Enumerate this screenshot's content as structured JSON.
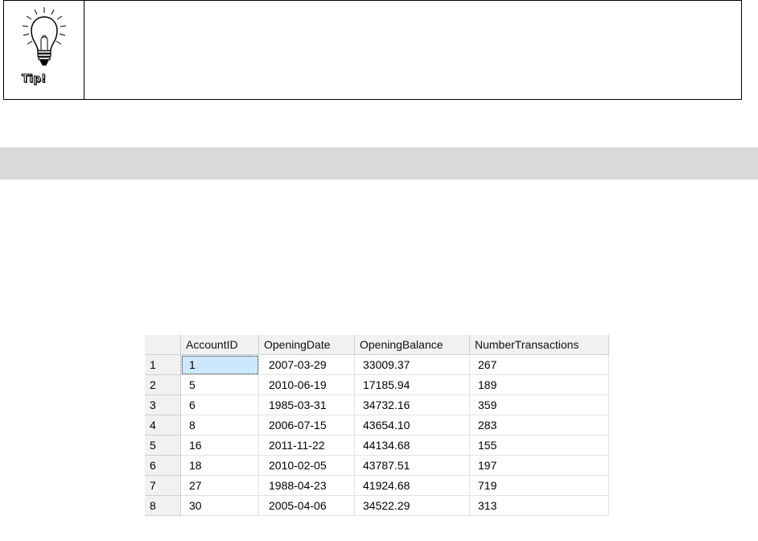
{
  "tip": {
    "label": "Tip!",
    "icon": "lightbulb-icon"
  },
  "grid": {
    "headers": [
      "AccountID",
      "OpeningDate",
      "OpeningBalance",
      "NumberTransactions"
    ],
    "rows": [
      {
        "num": "1",
        "account_id": "1",
        "opening_date": "2007-03-29",
        "opening_balance": "33009.37",
        "number_transactions": "267"
      },
      {
        "num": "2",
        "account_id": "5",
        "opening_date": "2010-06-19",
        "opening_balance": "17185.94",
        "number_transactions": "189"
      },
      {
        "num": "3",
        "account_id": "6",
        "opening_date": "1985-03-31",
        "opening_balance": "34732.16",
        "number_transactions": "359"
      },
      {
        "num": "4",
        "account_id": "8",
        "opening_date": "2006-07-15",
        "opening_balance": "43654.10",
        "number_transactions": "283"
      },
      {
        "num": "5",
        "account_id": "16",
        "opening_date": "2011-11-22",
        "opening_balance": "44134.68",
        "number_transactions": "155"
      },
      {
        "num": "6",
        "account_id": "18",
        "opening_date": "2010-02-05",
        "opening_balance": "43787.51",
        "number_transactions": "197"
      },
      {
        "num": "7",
        "account_id": "27",
        "opening_date": "1988-04-23",
        "opening_balance": "41924.68",
        "number_transactions": "719"
      },
      {
        "num": "8",
        "account_id": "30",
        "opening_date": "2005-04-06",
        "opening_balance": "34522.29",
        "number_transactions": "313"
      }
    ],
    "selected_cell": "account_id:0",
    "colors": {
      "selection": "#cce8ff",
      "header_bg": "#f1f1f1"
    }
  }
}
